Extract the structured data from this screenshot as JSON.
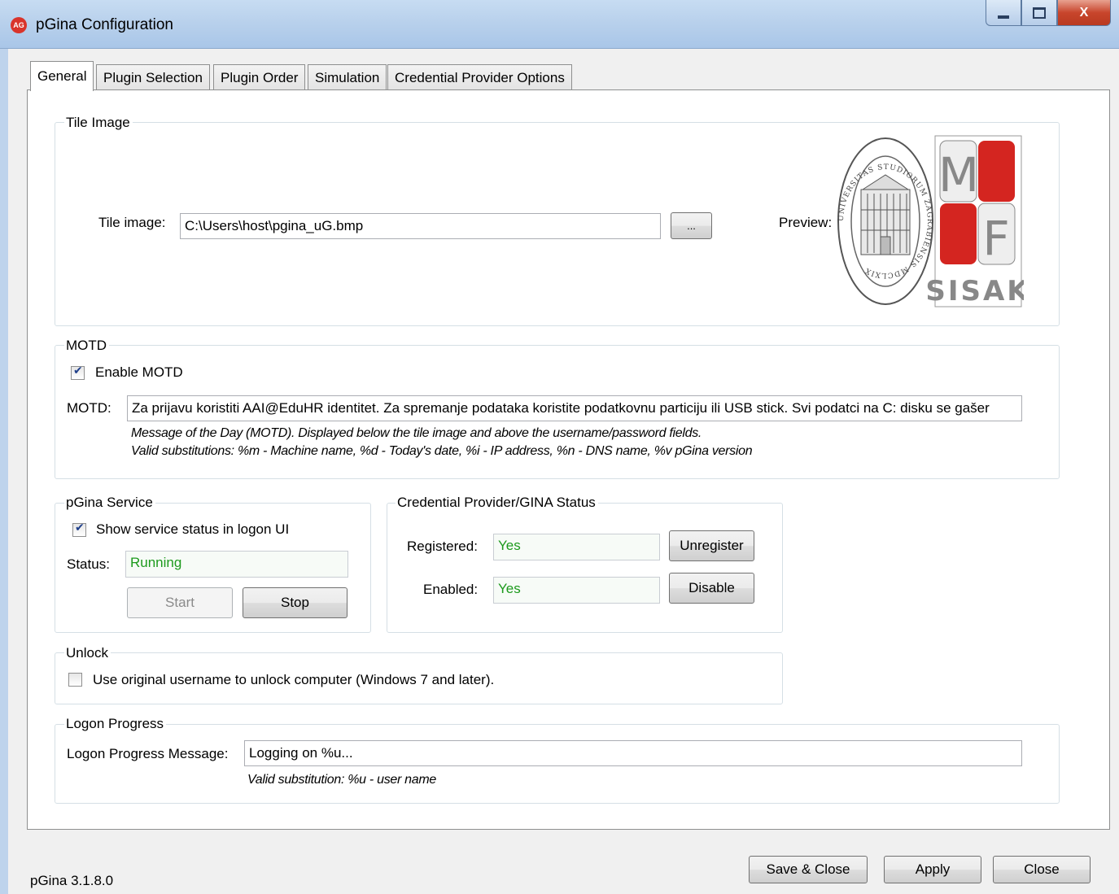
{
  "window": {
    "title": "pGina Configuration",
    "app_icon_text": "AG",
    "close_glyph": "X"
  },
  "tabs": [
    {
      "label": "General",
      "active": true
    },
    {
      "label": "Plugin Selection",
      "active": false
    },
    {
      "label": "Plugin Order",
      "active": false
    },
    {
      "label": "Simulation",
      "active": false
    },
    {
      "label": "Credential Provider Options",
      "active": false
    }
  ],
  "tile_image": {
    "group_label": "Tile Image",
    "field_label": "Tile image:",
    "path": "C:\\Users\\host\\pgina_uG.bmp",
    "browse_label": "...",
    "preview_label": "Preview:",
    "preview_logo": {
      "seal_text": "UNIVERSITAS STUDIORUM ZAGRABIENSIS MDCLXIX",
      "letters": [
        "M",
        "F"
      ],
      "caption": "SISAK"
    }
  },
  "motd": {
    "group_label": "MOTD",
    "enable_label": "Enable MOTD",
    "enabled": true,
    "field_label": "MOTD:",
    "value": "Za prijavu koristiti AAI@EduHR identitet. Za spremanje podataka koristite podatkovnu particiju ili USB stick. Svi podatci na C: disku se gašer",
    "hint_line1": "Message of the Day (MOTD).   Displayed below the tile image and  above the username/password fields.",
    "hint_line2": "Valid substitutions:   %m - Machine name, %d - Today's date, %i - IP address, %n - DNS name, %v pGina version"
  },
  "service": {
    "group_label": "pGina Service",
    "show_status_label": "Show service status in logon UI",
    "show_status": true,
    "status_label": "Status:",
    "status_value": "Running",
    "start_label": "Start",
    "stop_label": "Stop"
  },
  "cp_status": {
    "group_label": "Credential Provider/GINA Status",
    "registered_label": "Registered:",
    "registered_value": "Yes",
    "unregister_label": "Unregister",
    "enabled_label": "Enabled:",
    "enabled_value": "Yes",
    "disable_label": "Disable"
  },
  "unlock": {
    "group_label": "Unlock",
    "option_label": "Use original username to unlock computer (Windows 7 and later).",
    "checked": false
  },
  "logon_progress": {
    "group_label": "Logon Progress",
    "field_label": "Logon Progress Message:",
    "value": "Logging on %u...",
    "hint": "Valid substitution: %u - user name"
  },
  "footer": {
    "version": "pGina 3.1.8.0",
    "save_close_label": "Save & Close",
    "apply_label": "Apply",
    "close_label": "Close"
  }
}
